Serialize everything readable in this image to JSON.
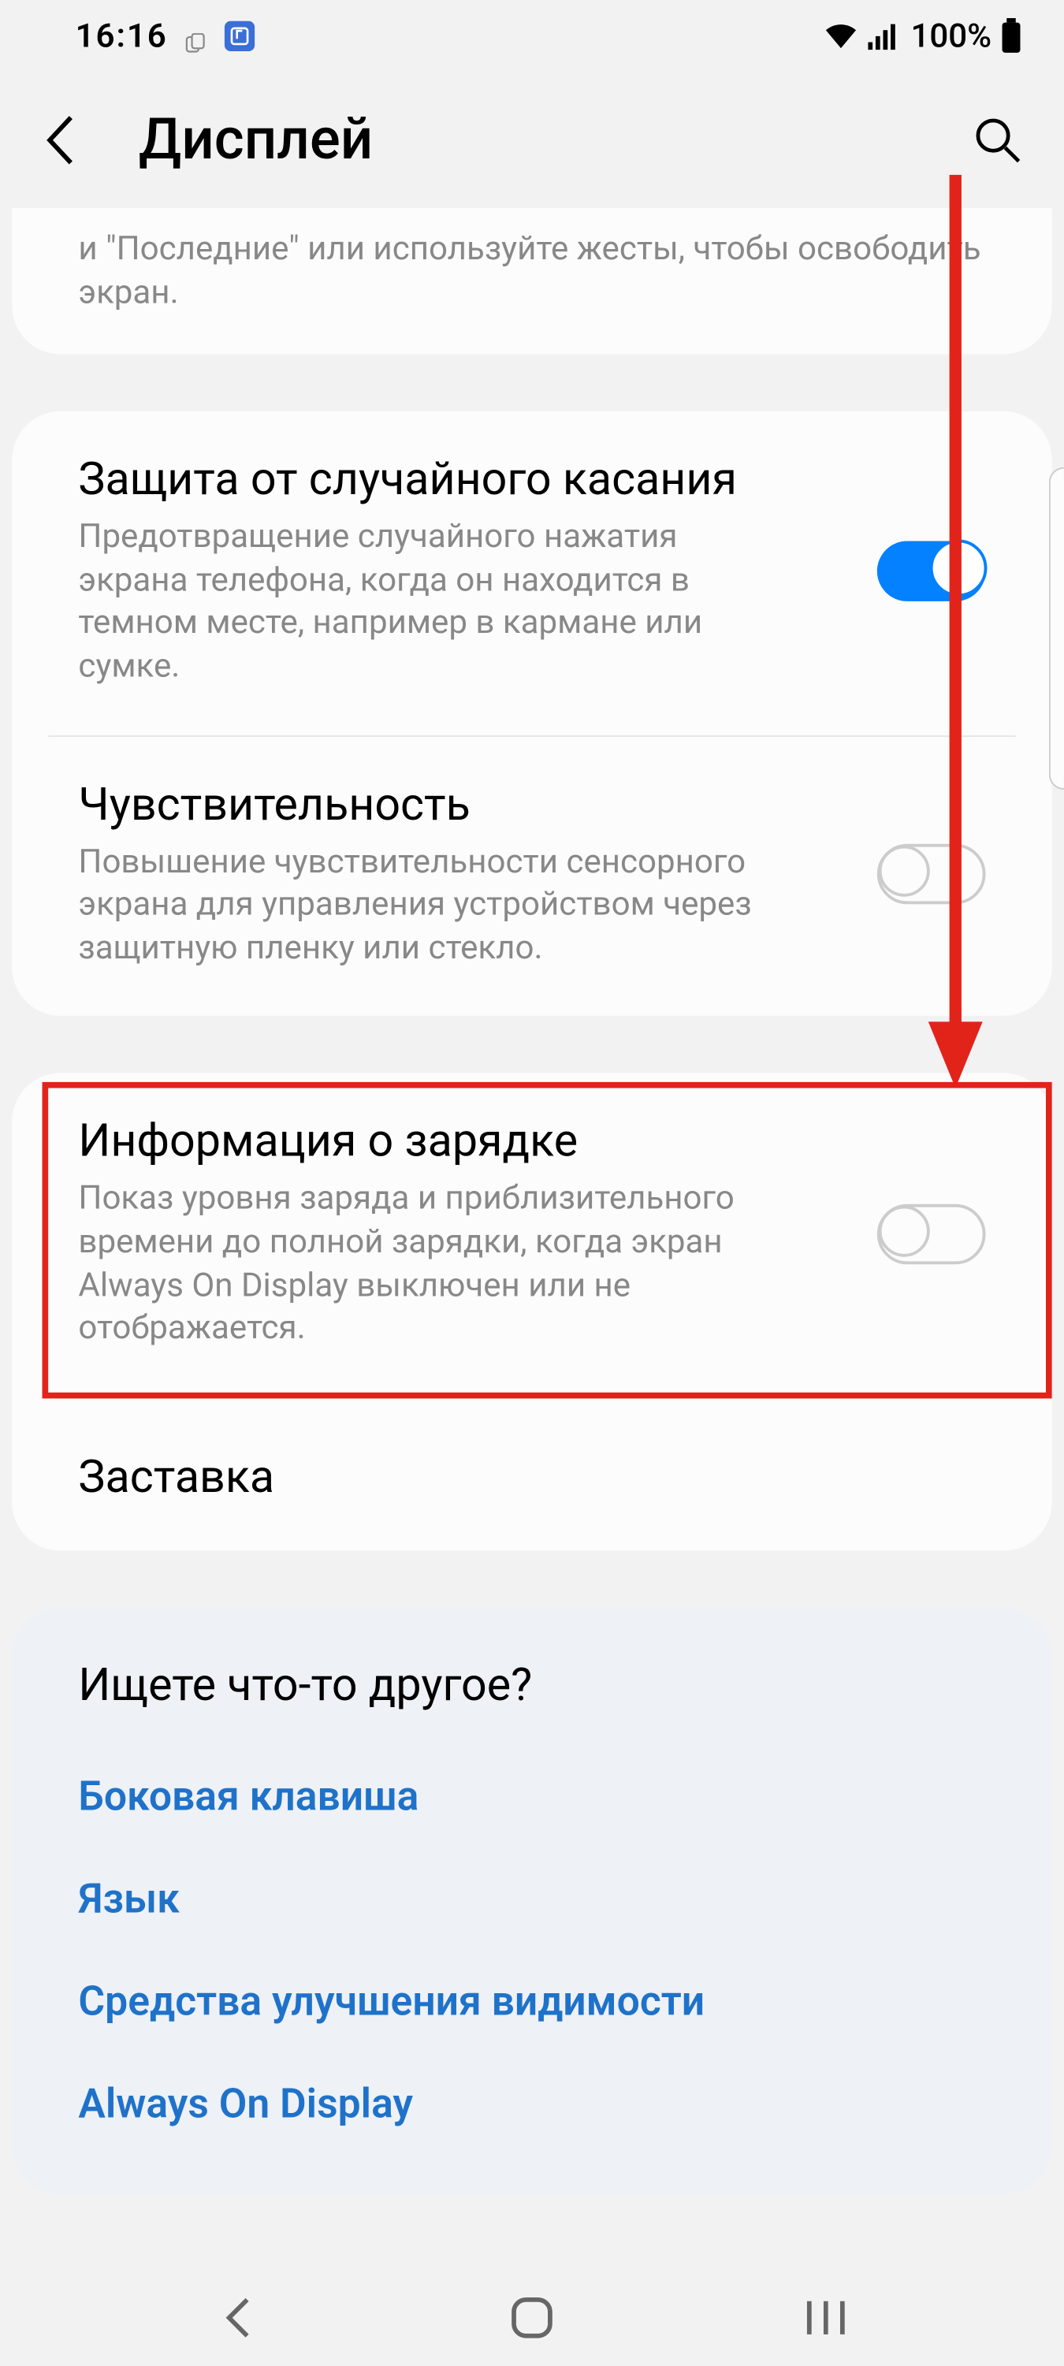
{
  "status": {
    "time": "16:16",
    "battery_text": "100%"
  },
  "header": {
    "title": "Дисплей"
  },
  "card0": {
    "partial_desc": "и \"Последние\" или используйте жесты, чтобы освободить экран."
  },
  "card1": {
    "item1_title": "Защита от случайного касания",
    "item1_desc": "Предотвращение случайного нажатия экрана телефона, когда он находится в темном месте, например в кармане или сумке.",
    "item2_title": "Чувствительность",
    "item2_desc": "Повышение чувствительности сенсорного экрана для управления устройством через защитную пленку или стекло."
  },
  "card2": {
    "item1_title": "Информация о зарядке",
    "item1_desc": "Показ уровня заряда и приблизительного времени до полной зарядки, когда экран Always On Display выключен или не отображается.",
    "item2_title": "Заставка"
  },
  "suggest": {
    "title": "Ищете что-то другое?",
    "link1": "Боковая клавиша",
    "link2": "Язык",
    "link3": "Средства улучшения видимости",
    "link4": "Always On Display"
  }
}
